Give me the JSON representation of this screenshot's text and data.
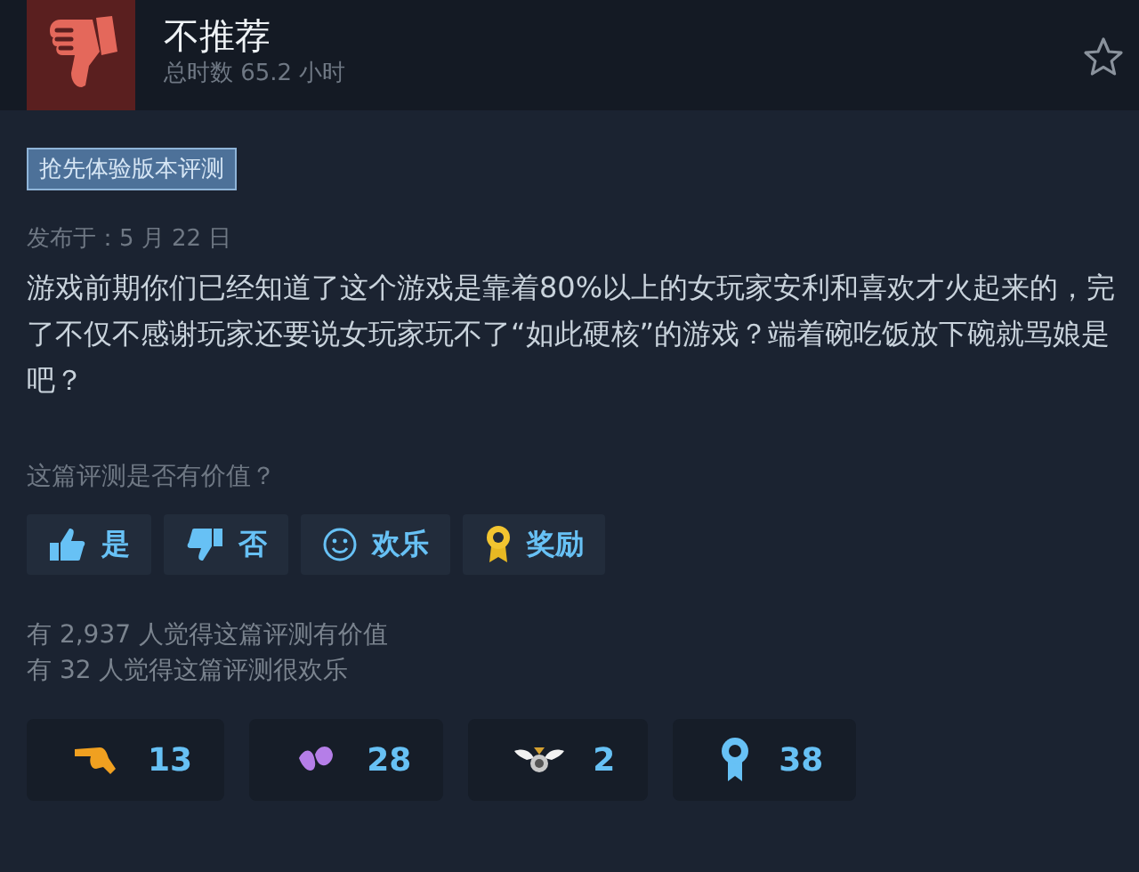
{
  "review": {
    "verdict": "不推荐",
    "playtime": "总时数 65.2 小时",
    "tag": "抢先体验版本评测",
    "date": "发布于：5 月 22 日",
    "body": "游戏前期你们已经知道了这个游戏是靠着80%以上的女玩家安利和喜欢才火起来的，完了不仅不感谢玩家还要说女玩家玩不了“如此硬核”的游戏？端着碗吃饭放下碗就骂娘是吧？"
  },
  "question": "这篇评测是否有价值？",
  "buttons": [
    {
      "kind": "up",
      "label": "是"
    },
    {
      "kind": "down",
      "label": "否"
    },
    {
      "kind": "smile",
      "label": "欢乐"
    },
    {
      "kind": "award",
      "label": "奖励"
    }
  ],
  "stats": [
    "有 2,937 人觉得这篇评测有价值",
    "有 32 人觉得这篇评测很欢乐"
  ],
  "awards": [
    {
      "kind": "hand",
      "count": "13"
    },
    {
      "kind": "petals",
      "count": "28"
    },
    {
      "kind": "wings",
      "count": "2"
    },
    {
      "kind": "ribbon",
      "count": "38"
    }
  ]
}
